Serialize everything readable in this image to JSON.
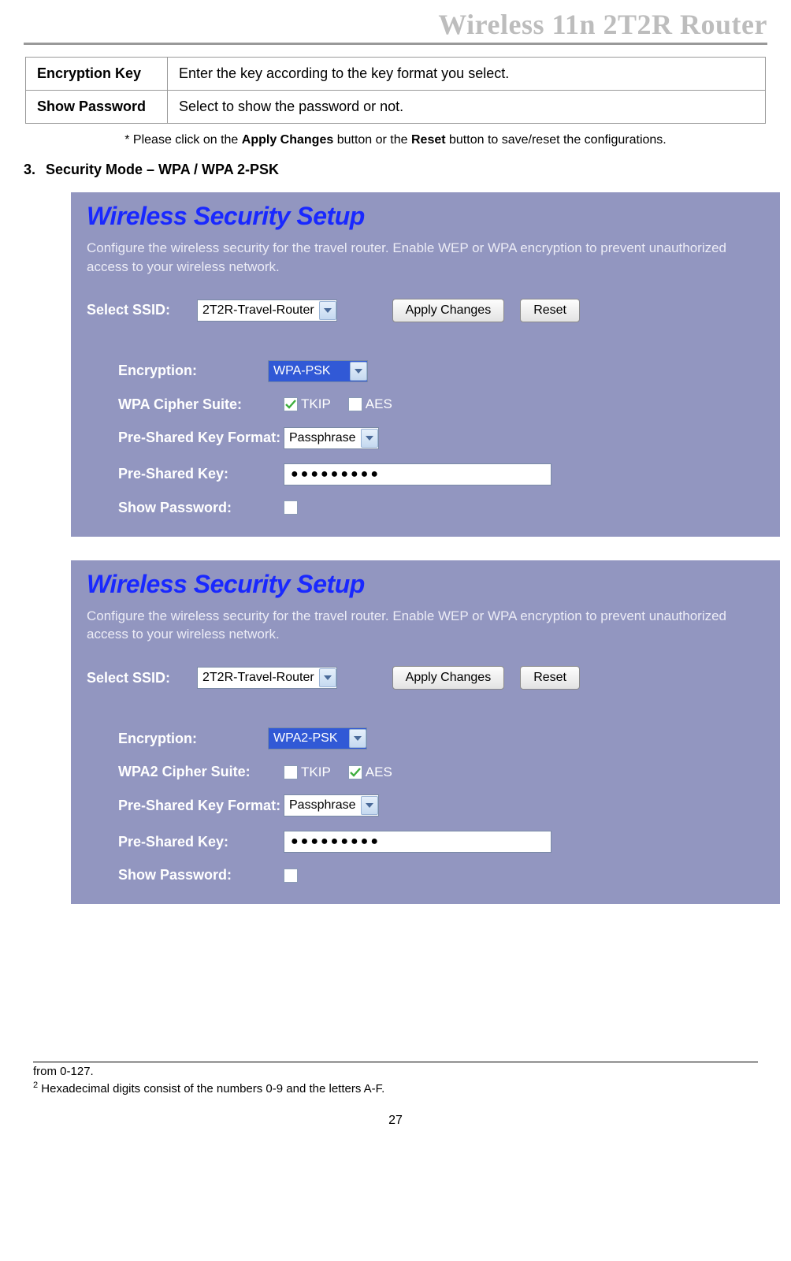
{
  "header": {
    "title": "Wireless 11n 2T2R Router"
  },
  "defs": {
    "rows": [
      {
        "label": "Encryption Key",
        "desc": "Enter the key according to the key format you select."
      },
      {
        "label": "Show Password",
        "desc": "Select to show the password or not."
      }
    ]
  },
  "note": {
    "prefix": "* Please click on the ",
    "b1": "Apply Changes",
    "mid": " button or the ",
    "b2": "Reset",
    "suffix": " button to save/reset the configurations."
  },
  "section": {
    "num": "3.",
    "title": "Security Mode – WPA / WPA 2-PSK"
  },
  "panel1": {
    "title": "Wireless Security Setup",
    "desc": "Configure the wireless security for the travel router. Enable WEP or WPA encryption to prevent unauthorized access to your wireless network.",
    "ssid_label": "Select SSID:",
    "ssid_value": "2T2R-Travel-Router",
    "apply": "Apply Changes",
    "reset": "Reset",
    "enc_label": "Encryption:",
    "enc_value": "WPA-PSK",
    "cipher_label": "WPA Cipher Suite:",
    "tkip": "TKIP",
    "aes": "AES",
    "tkip_checked": true,
    "aes_checked": false,
    "psk_format_label": "Pre-Shared Key Format:",
    "psk_format_value": "Passphrase",
    "psk_label": "Pre-Shared Key:",
    "psk_value": "●●●●●●●●●",
    "show_label": "Show Password:"
  },
  "panel2": {
    "title": "Wireless Security Setup",
    "desc": "Configure the wireless security for the travel router. Enable WEP or WPA encryption to prevent unauthorized access to your wireless network.",
    "ssid_label": "Select SSID:",
    "ssid_value": "2T2R-Travel-Router",
    "apply": "Apply Changes",
    "reset": "Reset",
    "enc_label": "Encryption:",
    "enc_value": "WPA2-PSK",
    "cipher_label": "WPA2 Cipher Suite:",
    "tkip": "TKIP",
    "aes": "AES",
    "tkip_checked": false,
    "aes_checked": true,
    "psk_format_label": "Pre-Shared Key Format:",
    "psk_format_value": "Passphrase",
    "psk_label": "Pre-Shared Key:",
    "psk_value": "●●●●●●●●●",
    "show_label": "Show Password:"
  },
  "foot": {
    "l1": " from 0-127.",
    "l2sup": "2",
    "l2": " Hexadecimal digits consist of the numbers 0-9 and the letters A-F."
  },
  "page": "27"
}
